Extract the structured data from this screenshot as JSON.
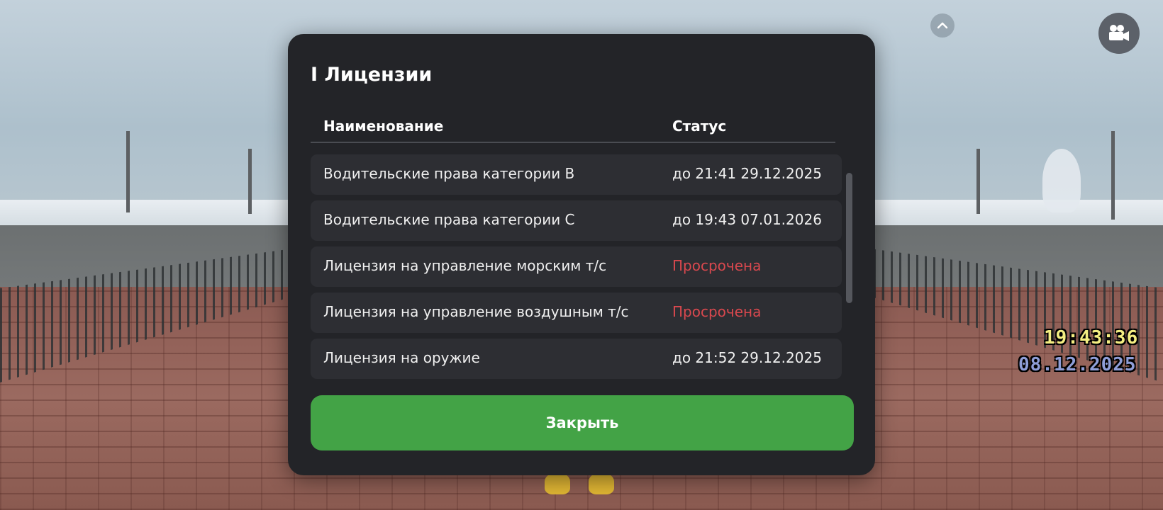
{
  "hud": {
    "time": "19:43:36",
    "date": "08.12.2025",
    "camera_icon": "video-camera-icon",
    "chevron_icon": "chevron-up-icon"
  },
  "dialog": {
    "title": "I Лицензии",
    "columns": {
      "name": "Наименование",
      "status": "Статус"
    },
    "rows": [
      {
        "name": "Водительские права категории B",
        "status": "до 21:41 29.12.2025",
        "expired": false
      },
      {
        "name": "Водительские права категории C",
        "status": "до 19:43 07.01.2026",
        "expired": false
      },
      {
        "name": "Лицензия на управление морским т/с",
        "status": "Просрочена",
        "expired": true
      },
      {
        "name": "Лицензия на управление воздушным т/с",
        "status": "Просрочена",
        "expired": true
      },
      {
        "name": "Лицензия на оружие",
        "status": "до 21:52 29.12.2025",
        "expired": false
      }
    ],
    "close_label": "Закрыть"
  },
  "colors": {
    "panel": "#232428",
    "row": "#2d2e33",
    "expired": "#d9484e",
    "button": "#43a346"
  }
}
